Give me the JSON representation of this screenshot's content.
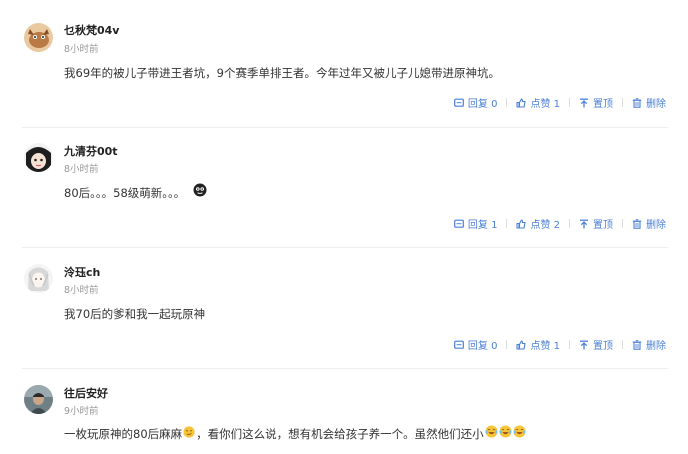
{
  "comments": [
    {
      "username": "乜秋梵04v",
      "time": "8小时前",
      "content": "我69年的被儿子带进王者坑，9个赛季单排王者。今年过年又被儿子儿媳带进原神坑。",
      "reply_label": "回复 0",
      "like_label": "点赞 1",
      "pin_label": "置顶",
      "delete_label": "删除"
    },
    {
      "username": "九清芬00t",
      "time": "8小时前",
      "content": "80后。。。58级萌新。。。",
      "reply_label": "回复 1",
      "like_label": "点赞 2",
      "pin_label": "置顶",
      "delete_label": "删除"
    },
    {
      "username": "泠珏ch",
      "time": "8小时前",
      "content": "我70后的爹和我一起玩原神",
      "reply_label": "回复 0",
      "like_label": "点赞 1",
      "pin_label": "置顶",
      "delete_label": "删除"
    },
    {
      "username": "往后安好",
      "time": "9小时前",
      "content_before": "一枚玩原神的80后麻麻",
      "content_middle": "，看你们这么说，想有机会给孩子养一个。虽然他们还小",
      "reply_label": "",
      "like_label": "",
      "pin_label": "",
      "delete_label": ""
    }
  ],
  "colors": {
    "action_blue": "#4a7fd6",
    "divider": "#eeeeee",
    "time_gray": "#999999"
  },
  "icons": {
    "reply": "reply-icon",
    "like": "thumbs-up-icon",
    "pin": "pin-top-icon",
    "delete": "trash-icon"
  }
}
